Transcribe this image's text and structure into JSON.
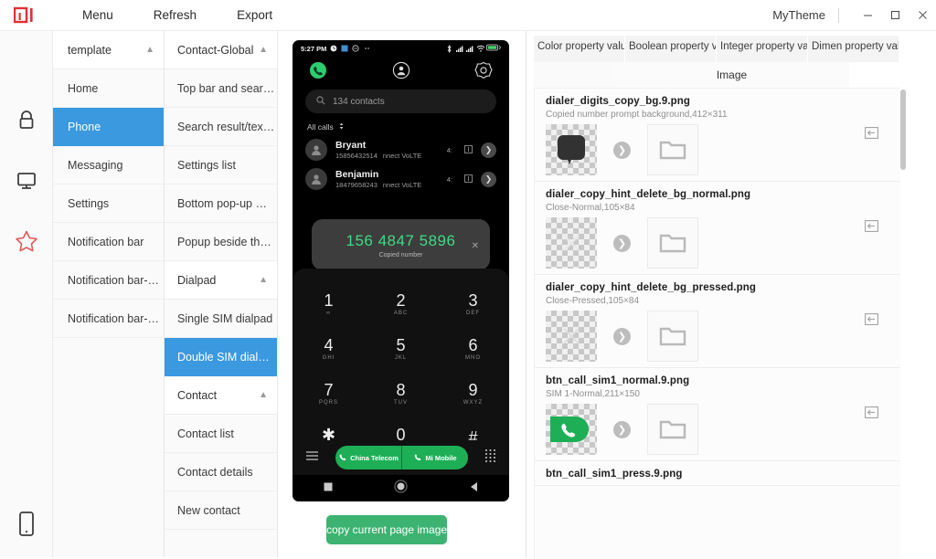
{
  "titlebar": {
    "logo": "mi-logo",
    "menus": [
      "Menu",
      "Refresh",
      "Export"
    ],
    "theme_label": "MyTheme",
    "minimize": "–",
    "maximize": "□",
    "close": "✕"
  },
  "rail": {
    "items": [
      {
        "name": "lock-icon"
      },
      {
        "name": "monitor-icon"
      },
      {
        "name": "star-icon",
        "color": "#e05a5a"
      },
      {
        "name": "phone-device-icon"
      }
    ]
  },
  "column1": {
    "group_header": "template",
    "items": [
      {
        "label": "Home",
        "selected": false
      },
      {
        "label": "Phone",
        "selected": true
      },
      {
        "label": "Messaging",
        "selected": false
      },
      {
        "label": "Settings",
        "selected": false
      },
      {
        "label": "Notification bar",
        "selected": false
      },
      {
        "label": "Notification bar-…",
        "selected": false
      },
      {
        "label": "Notification bar-…",
        "selected": false
      }
    ]
  },
  "column2": {
    "group_header": "Contact-Global",
    "items": [
      {
        "label": "Top bar and sear…",
        "type": "row",
        "selected": false
      },
      {
        "label": "Search result/tex…",
        "type": "row",
        "selected": false
      },
      {
        "label": "Settings list",
        "type": "row",
        "selected": false
      },
      {
        "label": "Bottom pop-up …",
        "type": "row",
        "selected": false
      },
      {
        "label": "Popup beside th…",
        "type": "row",
        "selected": false
      },
      {
        "label": "Dialpad",
        "type": "group",
        "selected": false
      },
      {
        "label": "Single SIM dialpad",
        "type": "row",
        "selected": false
      },
      {
        "label": "Double SIM dial…",
        "type": "row",
        "selected": true
      },
      {
        "label": "Contact",
        "type": "group",
        "selected": false
      },
      {
        "label": "Contact list",
        "type": "row",
        "selected": false
      },
      {
        "label": "Contact details",
        "type": "row",
        "selected": false
      },
      {
        "label": "New contact",
        "type": "row",
        "selected": false
      }
    ]
  },
  "preview": {
    "status_bar": {
      "time": "5:27 PM",
      "left_icons": [
        "alarm-icon",
        "screenshot-icon",
        "dnd-icon",
        "more-dots-icon"
      ],
      "right_icons": [
        "bluetooth-icon",
        "signal1-icon",
        "signal2-icon",
        "wifi-icon",
        "battery-icon"
      ]
    },
    "app_header_icons": [
      "phone-call-icon",
      "contacts-icon",
      "settings-gear-icon"
    ],
    "search": {
      "placeholder": "134 contacts",
      "icon": "search-icon"
    },
    "section_label": "All calls",
    "calls": [
      {
        "name": "Bryant",
        "number": "15856432514",
        "carrier": "nnect VoLTE",
        "time": "4:",
        "type_icon": "call-type-icon"
      },
      {
        "name": "Benjamin",
        "number": "18479658243",
        "carrier": "nnect VoLTE",
        "time": "4:",
        "type_icon": "call-type-icon"
      }
    ],
    "copied_toast": {
      "number": "156 4847 5896",
      "label": "Copied number",
      "close": "✕"
    },
    "dialpad_keys": [
      {
        "digit": "1",
        "sub": "∞"
      },
      {
        "digit": "2",
        "sub": "ABC"
      },
      {
        "digit": "3",
        "sub": "DEF"
      },
      {
        "digit": "4",
        "sub": "GHI"
      },
      {
        "digit": "5",
        "sub": "JKL"
      },
      {
        "digit": "6",
        "sub": "MNO"
      },
      {
        "digit": "7",
        "sub": "PQRS"
      },
      {
        "digit": "8",
        "sub": "TUV"
      },
      {
        "digit": "9",
        "sub": "WXYZ"
      },
      {
        "digit": "✱",
        "sub": ","
      },
      {
        "digit": "0",
        "sub": "+"
      },
      {
        "digit": "#",
        "sub": ""
      }
    ],
    "call_buttons": [
      {
        "label": "China Telecom",
        "icon": "call-icon"
      },
      {
        "label": "Mi Mobile",
        "icon": "call-icon"
      }
    ],
    "bottom_left_icon": "menu-lines-icon",
    "bottom_right_icon": "keypad-icon",
    "navbar_icons": [
      "recents-square-icon",
      "home-circle-icon",
      "back-triangle-icon"
    ],
    "copy_button": "copy current page image",
    "accent_green": "#1eaf56",
    "toast_green": "#3ddc84"
  },
  "right_panel": {
    "tabs": [
      {
        "label": "Color property value",
        "selected": false
      },
      {
        "label": "Boolean property value",
        "selected": false
      },
      {
        "label": "Integer property value",
        "selected": false
      },
      {
        "label": "Dimen property value",
        "selected": false
      }
    ],
    "subtab": "Image",
    "items": [
      {
        "name": "dialer_digits_copy_bg.9.png",
        "desc": "Copied number prompt background,412×311",
        "thumb": "rounded-dark-bubble",
        "arrow": "❯",
        "folder_icon": "folder-icon",
        "export_icon": "import-replace-icon"
      },
      {
        "name": "dialer_copy_hint_delete_bg_normal.png",
        "desc": "Close-Normal,105×84",
        "thumb": "close-x-light",
        "arrow": "❯",
        "folder_icon": "folder-icon",
        "export_icon": "import-replace-icon"
      },
      {
        "name": "dialer_copy_hint_delete_bg_pressed.png",
        "desc": "Close-Pressed,105×84",
        "thumb": "close-x-faint",
        "arrow": "❯",
        "folder_icon": "folder-icon",
        "export_icon": "import-replace-icon"
      },
      {
        "name": "btn_call_sim1_normal.9.png",
        "desc": "SIM 1-Normal,211×150",
        "thumb": "green-call-pill",
        "arrow": "❯",
        "folder_icon": "folder-icon",
        "export_icon": "import-replace-icon"
      },
      {
        "name": "btn_call_sim1_press.9.png",
        "desc": "",
        "thumb": "",
        "arrow": "❯",
        "folder_icon": "folder-icon",
        "export_icon": "import-replace-icon"
      }
    ]
  }
}
